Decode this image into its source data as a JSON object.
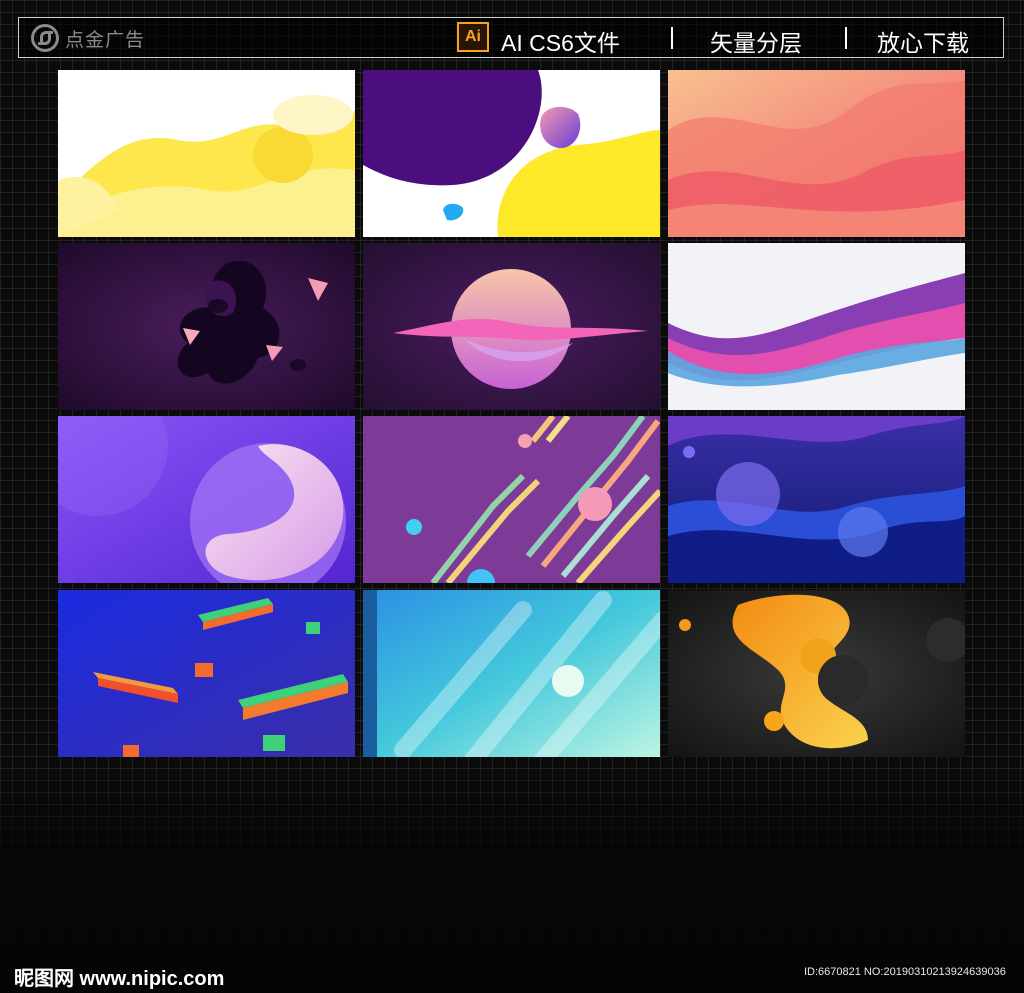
{
  "header": {
    "logo_text": "点金广告",
    "ai_badge": "Ai",
    "items": [
      "AI CS6文件",
      "矢量分层",
      "放心下载"
    ]
  },
  "gallery": {
    "rows": 4,
    "columns": 3,
    "thumbnails": [
      {
        "theme": "yellow-fluid",
        "colors": [
          "#ffffff",
          "#fde74c",
          "#fbe96a"
        ]
      },
      {
        "theme": "purple-yellow-blob",
        "colors": [
          "#4b0e7e",
          "#fde82a",
          "#ffffff"
        ]
      },
      {
        "theme": "coral-waves",
        "colors": [
          "#f7b288",
          "#ef5f6a",
          "#f58b6b"
        ]
      },
      {
        "theme": "dark-purple-liquid",
        "colors": [
          "#2a0d3a",
          "#14061e",
          "#f38aa3"
        ]
      },
      {
        "theme": "neon-planet",
        "colors": [
          "#3b1552",
          "#f9c9b0",
          "#d56fd2"
        ]
      },
      {
        "theme": "purple-ribbon-wave",
        "colors": [
          "#f2f3f7",
          "#8a3eb3",
          "#e24fae"
        ]
      },
      {
        "theme": "violet-sphere",
        "colors": [
          "#7b45f5",
          "#f3c8e8",
          "#5a2ad8"
        ]
      },
      {
        "theme": "diagonal-stripes",
        "colors": [
          "#7f3a98",
          "#f2d678",
          "#41d0f1"
        ]
      },
      {
        "theme": "blue-bokeh-waves",
        "colors": [
          "#2b2e9c",
          "#5a3ee0",
          "#0e1a78"
        ]
      },
      {
        "theme": "isometric-bars",
        "colors": [
          "#1d2bd0",
          "#f46b2e",
          "#3fd07a"
        ]
      },
      {
        "theme": "cyan-gradient-streaks",
        "colors": [
          "#2f9be3",
          "#4fd9d2",
          "#b9f3e2"
        ]
      },
      {
        "theme": "gold-fluid-dark",
        "colors": [
          "#1a1a1a",
          "#f6a21a",
          "#fbd24e"
        ]
      }
    ]
  },
  "watermark": {
    "site": "昵图网 www.nipic.com",
    "id_text": "ID:6670821 NO:20190310213924639036"
  }
}
